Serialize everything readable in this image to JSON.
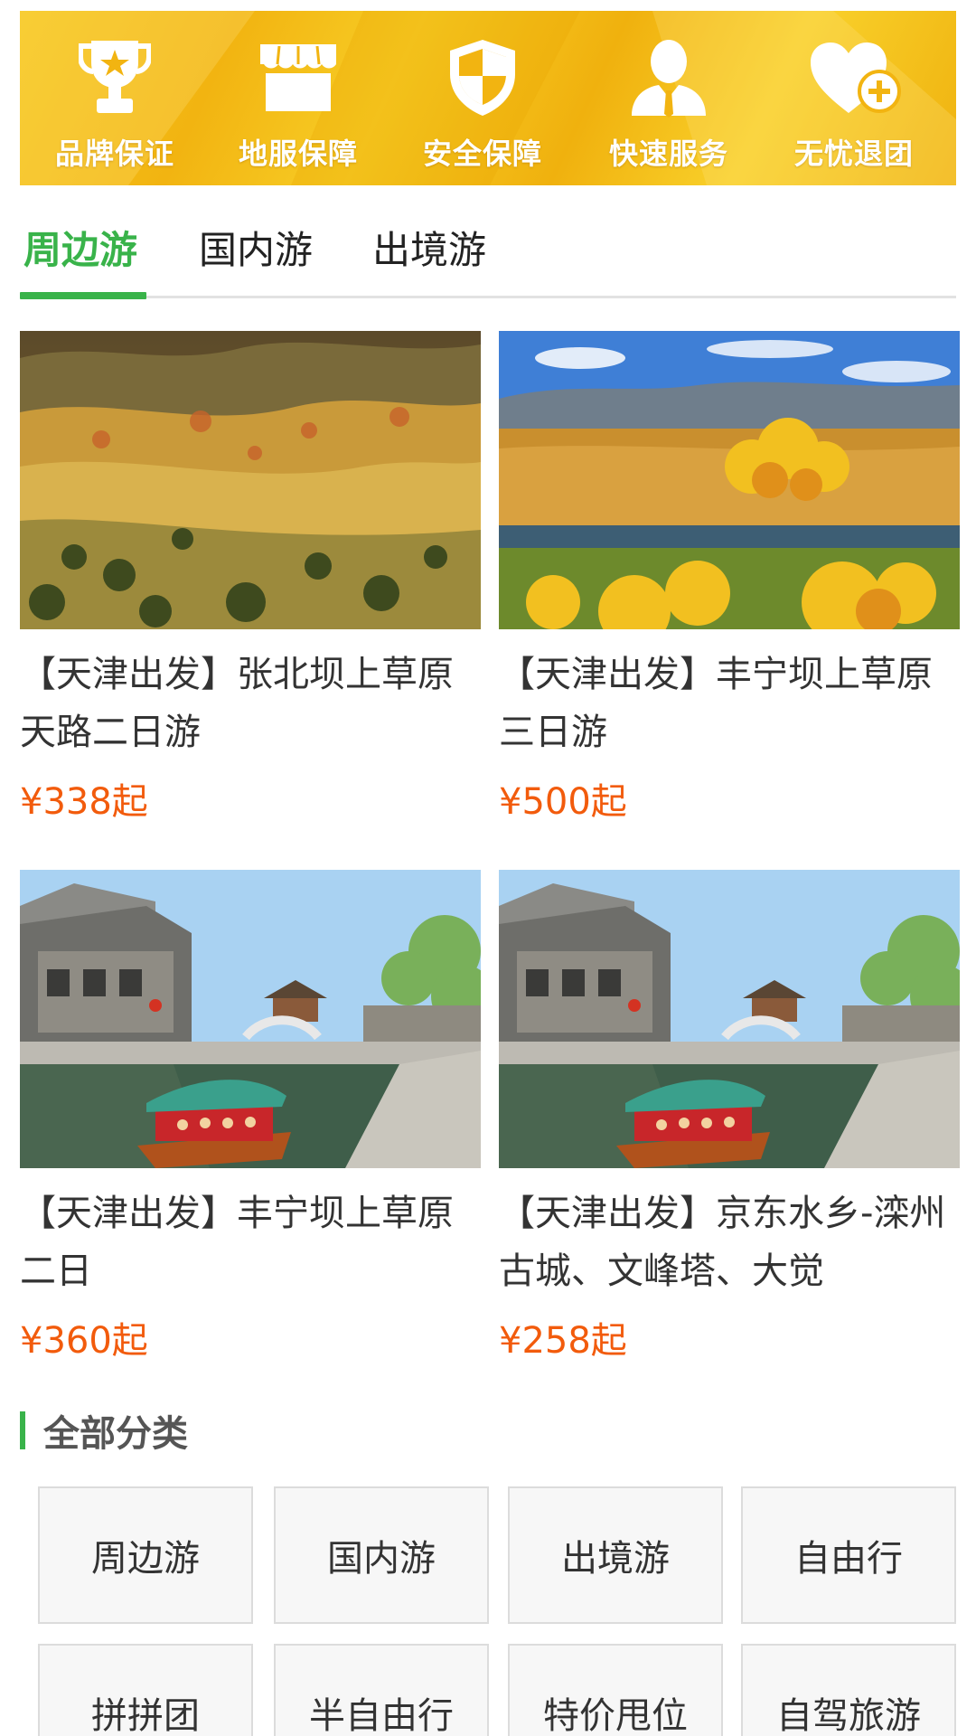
{
  "banner": {
    "items": [
      {
        "label": "品牌保证",
        "icon": "trophy-icon"
      },
      {
        "label": "地服保障",
        "icon": "storefront-icon"
      },
      {
        "label": "安全保障",
        "icon": "shield-icon"
      },
      {
        "label": "快速服务",
        "icon": "agent-icon"
      },
      {
        "label": "无忧退团",
        "icon": "heart-plus-icon"
      }
    ]
  },
  "tabs": [
    {
      "label": "周边游",
      "active": true
    },
    {
      "label": "国内游",
      "active": false
    },
    {
      "label": "出境游",
      "active": false
    }
  ],
  "products": [
    {
      "title": "【天津出发】张北坝上草原天路二日游",
      "price": "¥338起",
      "image": "autumn-grassland-hills"
    },
    {
      "title": "【天津出发】丰宁坝上草原三日游",
      "price": "¥500起",
      "image": "golden-trees-lake"
    },
    {
      "title": "【天津出发】丰宁坝上草原二日",
      "price": "¥360起",
      "image": "ancient-town-canal-boat"
    },
    {
      "title": "【天津出发】京东水乡-滦州古城、文峰塔、大觉",
      "price": "¥258起",
      "image": "ancient-town-canal-boat"
    }
  ],
  "categories": {
    "heading": "全部分类",
    "items": [
      "周边游",
      "国内游",
      "出境游",
      "自由行",
      "拼拼团",
      "半自由行",
      "特价甩位",
      "自驾旅游"
    ]
  },
  "colors": {
    "accent": "#39b34a",
    "price": "#f25b0c",
    "banner": "#f5c11a"
  }
}
